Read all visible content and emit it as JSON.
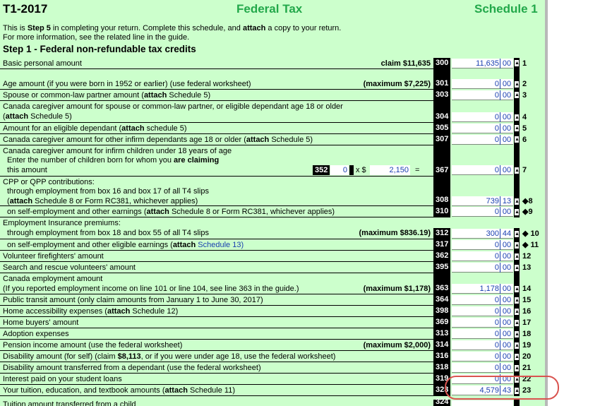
{
  "header": {
    "form_id": "T1-2017",
    "title": "Federal Tax",
    "schedule": "Schedule 1"
  },
  "intro": {
    "a": "This is ",
    "b": "Step 5",
    "c": " in completing your return. Complete this schedule, and ",
    "d": "attach",
    "e": " a copy to your return.",
    "line2": "For more information, see the related line in the guide."
  },
  "step_title": "Step 1 - Federal non-refundable tax credits",
  "lines": {
    "l1": {
      "label": "Basic personal amount",
      "note": "claim $11,635",
      "code": "300",
      "dollars": "11,635",
      "cents": "00",
      "num": "1"
    },
    "l2": {
      "label": "Age amount (if you were born in 1952 or earlier) (use federal worksheet)",
      "note": "(maximum $7,225)",
      "code": "301",
      "dollars": "0",
      "cents": "00",
      "num": "2"
    },
    "l3": {
      "a": "Spouse or common-law partner amount (",
      "b": "attach",
      "c": " Schedule 5)",
      "code": "303",
      "dollars": "0",
      "cents": "00",
      "num": "3"
    },
    "l4": {
      "label1": "Canada caregiver amount for spouse or common-law partner, or eligible dependant age 18 or older",
      "b": "attach",
      "c": " Schedule 5)",
      "code": "304",
      "dollars": "0",
      "cents": "00",
      "num": "4"
    },
    "l5": {
      "a": "Amount for an eligible dependant (",
      "b": "attach",
      "c": " schedule 5)",
      "code": "305",
      "dollars": "0",
      "cents": "00",
      "num": "5"
    },
    "l6": {
      "a": "Canada caregiver amount for other infirm dependants age 18 or older (",
      "b": "attach",
      "c": " Schedule 5)",
      "code": "307",
      "dollars": "0",
      "cents": "00",
      "num": "6"
    },
    "l7": {
      "label1": "Canada caregiver amount for infirm children under 18 years of age",
      "b1": "Enter the number of children born for whom you ",
      "b2": "are claiming",
      "label3": "this amount",
      "code352": "352",
      "children": "0",
      "times": "x $",
      "rate": "2,150",
      "eq": "=",
      "code": "367",
      "dollars": "0",
      "cents": "00",
      "num": "7"
    },
    "cpp": {
      "head": "CPP or QPP contributions:",
      "l8a": "through employment from box 16 and box 17 of all T4 slips",
      "l8b": "attach",
      "l8c": " Schedule 8 or Form RC381, whichever applies)",
      "code8": "308",
      "d8": "739",
      "c8": "13",
      "n8": "◆8",
      "l9a": "on self-employment and other earnings (",
      "l9b": "attach",
      "l9c": " Schedule 8 or Form RC381, whichever applies)",
      "code9": "310",
      "d9": "0",
      "c9": "00",
      "n9": "◆9"
    },
    "ei": {
      "head": "Employment Insurance premiums:",
      "l10a": "through employment from box 18 and box 55 of all T4 slips",
      "note": "(maximum $836.19)",
      "code10": "312",
      "d10": "300",
      "c10": "44",
      "n10": "◆ 10",
      "l11a": "on self-employment and other eligible earnings (",
      "l11b": "attach",
      "l11link": "Schedule 13)",
      "code11": "317",
      "d11": "0",
      "c11": "00",
      "n11": "◆ 11"
    },
    "simple": [
      {
        "parts": [
          {
            "t": "Volunteer firefighters' amount"
          }
        ],
        "code": "362",
        "dollars": "0",
        "cents": "00",
        "num": "12",
        "h": 16
      },
      {
        "parts": [
          {
            "t": "Search and rescue volunteers' amount"
          }
        ],
        "code": "395",
        "dollars": "0",
        "cents": "00",
        "num": "13",
        "h": 16
      },
      {
        "parts": [
          {
            "t": "Canada employment amount"
          }
        ],
        "line2": "(If you reported employment income on line 101 or line 104, see line 363 in the guide.)",
        "note": "(maximum $1,178)",
        "code": "363",
        "dollars": "1,178",
        "cents": "00",
        "num": "14",
        "h": 30
      },
      {
        "parts": [
          {
            "t": "Public transit amount (only claim amounts from January 1 to June 30, 2017)"
          }
        ],
        "code": "364",
        "dollars": "0",
        "cents": "00",
        "num": "15",
        "h": 16
      },
      {
        "parts": [
          {
            "t": "Home accessibility expenses ("
          },
          {
            "t": "attach",
            "b": true
          },
          {
            "t": " Schedule 12)"
          }
        ],
        "code": "398",
        "dollars": "0",
        "cents": "00",
        "num": "16",
        "h": 16
      },
      {
        "parts": [
          {
            "t": "Home buyers' amount"
          }
        ],
        "code": "369",
        "dollars": "0",
        "cents": "00",
        "num": "17",
        "h": 16
      },
      {
        "parts": [
          {
            "t": "Adoption expenses"
          }
        ],
        "code": "313",
        "dollars": "0",
        "cents": "00",
        "num": "18",
        "h": 16
      },
      {
        "parts": [
          {
            "t": "Pension income amount (use the federal worksheet)"
          }
        ],
        "note": "(maximum $2,000)",
        "code": "314",
        "dollars": "0",
        "cents": "00",
        "num": "19",
        "h": 16
      },
      {
        "parts": [
          {
            "t": "Disability amount (for self) (claim "
          },
          {
            "t": "$8,113",
            "b": true
          },
          {
            "t": ", or if you were under age 18, use the federal worksheet)"
          }
        ],
        "code": "316",
        "dollars": "0",
        "cents": "00",
        "num": "20",
        "h": 16
      },
      {
        "parts": [
          {
            "t": "Disability amount transferred from a dependant (use the federal worksheet)"
          }
        ],
        "code": "318",
        "dollars": "0",
        "cents": "00",
        "num": "21",
        "h": 16
      },
      {
        "parts": [
          {
            "t": "Interest paid on your student loans"
          }
        ],
        "code": "319",
        "dollars": "0",
        "cents": "00",
        "num": "22",
        "h": 16
      },
      {
        "parts": [
          {
            "t": "Your tuition, education, and textbook amounts ("
          },
          {
            "t": "attach",
            "b": true
          },
          {
            "t": " Schedule 11)"
          }
        ],
        "code": "323",
        "dollars": "4,579",
        "cents": "43",
        "num": "23",
        "h": 16
      }
    ],
    "l24": {
      "label": "Tuition amount transferred from a child",
      "code": "324"
    }
  }
}
